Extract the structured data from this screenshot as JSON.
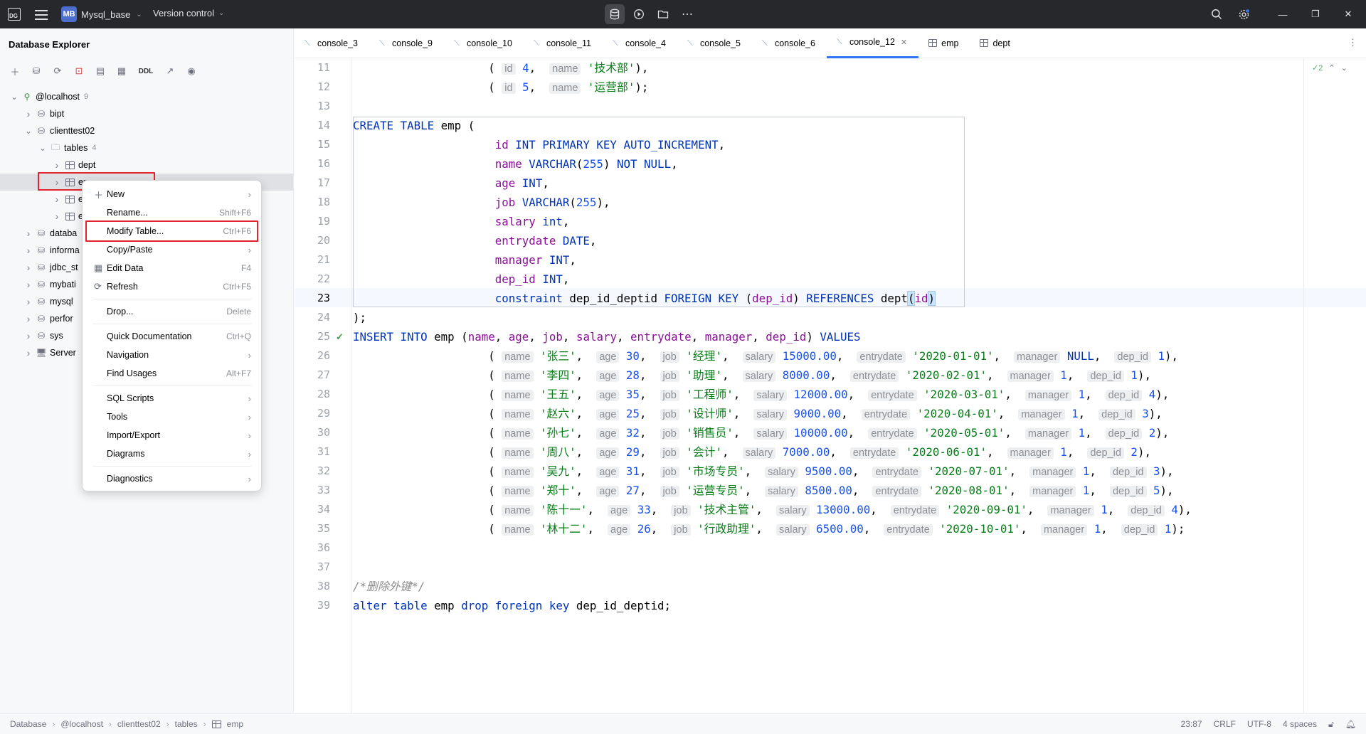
{
  "titlebar": {
    "project_badge": "MB",
    "project_name": "Mysql_base",
    "version_control": "Version control"
  },
  "left_panel": {
    "title": "Database Explorer",
    "ddl_label": "DDL",
    "tree": [
      {
        "label": "@localhost",
        "count": "9",
        "level": 0,
        "expanded": true,
        "icon": "host-icon"
      },
      {
        "label": "bipt",
        "level": 1,
        "icon": "schema-icon"
      },
      {
        "label": "clienttest02",
        "level": 1,
        "expanded": true,
        "icon": "schema-icon"
      },
      {
        "label": "tables",
        "count": "4",
        "level": 2,
        "expanded": true,
        "icon": "folder-icon"
      },
      {
        "label": "dept",
        "level": 3,
        "icon": "table-icon"
      },
      {
        "label": "emp",
        "level": 3,
        "icon": "table-icon",
        "selected": true
      },
      {
        "label": "e",
        "level": 3,
        "icon": "table-icon"
      },
      {
        "label": "e",
        "level": 3,
        "icon": "table-icon"
      },
      {
        "label": "databa",
        "level": 1,
        "icon": "schema-icon"
      },
      {
        "label": "informa",
        "level": 1,
        "icon": "schema-icon"
      },
      {
        "label": "jdbc_st",
        "level": 1,
        "icon": "schema-icon"
      },
      {
        "label": "mybati",
        "level": 1,
        "icon": "schema-icon"
      },
      {
        "label": "mysql",
        "level": 1,
        "icon": "schema-icon"
      },
      {
        "label": "perfor",
        "level": 1,
        "icon": "schema-icon"
      },
      {
        "label": "sys",
        "level": 1,
        "icon": "schema-icon"
      },
      {
        "label": "Server",
        "level": 1,
        "icon": "server-icon"
      }
    ]
  },
  "context_menu": {
    "items": [
      {
        "label": "New",
        "shortcut": "",
        "submenu": true,
        "icon": "plus-icon"
      },
      {
        "label": "Rename...",
        "shortcut": "Shift+F6"
      },
      {
        "label": "Modify Table...",
        "shortcut": "Ctrl+F6",
        "highlighted": true
      },
      {
        "label": "Copy/Paste",
        "shortcut": "",
        "submenu": true
      },
      {
        "label": "Edit Data",
        "shortcut": "F4",
        "icon": "table-icon"
      },
      {
        "label": "Refresh",
        "shortcut": "Ctrl+F5",
        "icon": "refresh-icon"
      },
      {
        "sep": true
      },
      {
        "label": "Drop...",
        "shortcut": "Delete"
      },
      {
        "sep": true
      },
      {
        "label": "Quick Documentation",
        "shortcut": "Ctrl+Q"
      },
      {
        "label": "Navigation",
        "shortcut": "",
        "submenu": true
      },
      {
        "label": "Find Usages",
        "shortcut": "Alt+F7"
      },
      {
        "sep": true
      },
      {
        "label": "SQL Scripts",
        "shortcut": "",
        "submenu": true
      },
      {
        "label": "Tools",
        "shortcut": "",
        "submenu": true
      },
      {
        "label": "Import/Export",
        "shortcut": "",
        "submenu": true
      },
      {
        "label": "Diagrams",
        "shortcut": "",
        "submenu": true
      },
      {
        "sep": true
      },
      {
        "label": "Diagnostics",
        "shortcut": "",
        "submenu": true
      }
    ]
  },
  "tabs": [
    {
      "label": "console_3",
      "type": "console"
    },
    {
      "label": "console_9",
      "type": "console"
    },
    {
      "label": "console_10",
      "type": "console"
    },
    {
      "label": "console_11",
      "type": "console"
    },
    {
      "label": "console_4",
      "type": "console"
    },
    {
      "label": "console_5",
      "type": "console"
    },
    {
      "label": "console_6",
      "type": "console"
    },
    {
      "label": "console_12",
      "type": "console",
      "active": true
    },
    {
      "label": "emp",
      "type": "table"
    },
    {
      "label": "dept",
      "type": "table"
    }
  ],
  "editor": {
    "inspection_count": "2",
    "current_line": 23,
    "lines": [
      {
        "n": "11",
        "html": "                    <span>( </span><span class=\"hint\">id</span> <span class=\"num\">4</span>,  <span class=\"hint\">name</span> <span class=\"str\">'技术部'</span>),"
      },
      {
        "n": "12",
        "html": "                    <span>( </span><span class=\"hint\">id</span> <span class=\"num\">5</span>,  <span class=\"hint\">name</span> <span class=\"str\">'运营部'</span>);"
      },
      {
        "n": "13",
        "html": ""
      },
      {
        "n": "14",
        "html": "<span class=\"kw\">CREATE TABLE</span> emp ("
      },
      {
        "n": "15",
        "html": "                     <span class=\"id\">id</span> <span class=\"kw\">INT PRIMARY KEY AUTO_INCREMENT</span>,"
      },
      {
        "n": "16",
        "html": "                     <span class=\"id\">name</span> <span class=\"kw\">VARCHAR</span>(<span class=\"num\">255</span>) <span class=\"kw\">NOT NULL</span>,"
      },
      {
        "n": "17",
        "html": "                     <span class=\"id\">age</span> <span class=\"kw\">INT</span>,"
      },
      {
        "n": "18",
        "html": "                     <span class=\"id\">job</span> <span class=\"kw\">VARCHAR</span>(<span class=\"num\">255</span>),"
      },
      {
        "n": "19",
        "html": "                     <span class=\"id\">salary</span> <span class=\"kw\">int</span>,"
      },
      {
        "n": "20",
        "html": "                     <span class=\"id\">entrydate</span> <span class=\"kw\">DATE</span>,"
      },
      {
        "n": "21",
        "html": "                     <span class=\"id\">manager</span> <span class=\"kw\">INT</span>,"
      },
      {
        "n": "22",
        "html": "                     <span class=\"id\">dep_id</span> <span class=\"kw\">INT</span>,"
      },
      {
        "n": "23",
        "html": "                     <span class=\"kw\">constraint</span> dep_id_deptid <span class=\"kw\">FOREIGN KEY</span> (<span class=\"id\">dep_id</span>) <span class=\"kw\">REFERENCES</span> dept<span class=\"brace\">(</span><span class=\"id\">id</span><span class=\"brace\">)</span>"
      },
      {
        "n": "24",
        "html": ");"
      },
      {
        "n": "25",
        "html": "<span class=\"kw\">INSERT INTO</span> emp (<span class=\"id\">name</span>, <span class=\"id\">age</span>, <span class=\"id\">job</span>, <span class=\"id\">salary</span>, <span class=\"id\">entrydate</span>, <span class=\"id\">manager</span>, <span class=\"id\">dep_id</span>) <span class=\"kw\">VALUES</span>"
      },
      {
        "n": "26",
        "html": "                    ( <span class=\"hint\">name</span> <span class=\"str\">'张三'</span>,  <span class=\"hint\">age</span> <span class=\"num\">30</span>,  <span class=\"hint\">job</span> <span class=\"str\">'经理'</span>,  <span class=\"hint\">salary</span> <span class=\"num\">15000.00</span>,  <span class=\"hint\">entrydate</span> <span class=\"str\">'2020-01-01'</span>,  <span class=\"hint\">manager</span> <span class=\"kw\">NULL</span>,  <span class=\"hint\">dep_id</span> <span class=\"num\">1</span>),"
      },
      {
        "n": "27",
        "html": "                    ( <span class=\"hint\">name</span> <span class=\"str\">'李四'</span>,  <span class=\"hint\">age</span> <span class=\"num\">28</span>,  <span class=\"hint\">job</span> <span class=\"str\">'助理'</span>,  <span class=\"hint\">salary</span> <span class=\"num\">8000.00</span>,  <span class=\"hint\">entrydate</span> <span class=\"str\">'2020-02-01'</span>,  <span class=\"hint\">manager</span> <span class=\"num\">1</span>,  <span class=\"hint\">dep_id</span> <span class=\"num\">1</span>),"
      },
      {
        "n": "28",
        "html": "                    ( <span class=\"hint\">name</span> <span class=\"str\">'王五'</span>,  <span class=\"hint\">age</span> <span class=\"num\">35</span>,  <span class=\"hint\">job</span> <span class=\"str\">'工程师'</span>,  <span class=\"hint\">salary</span> <span class=\"num\">12000.00</span>,  <span class=\"hint\">entrydate</span> <span class=\"str\">'2020-03-01'</span>,  <span class=\"hint\">manager</span> <span class=\"num\">1</span>,  <span class=\"hint\">dep_id</span> <span class=\"num\">4</span>),"
      },
      {
        "n": "29",
        "html": "                    ( <span class=\"hint\">name</span> <span class=\"str\">'赵六'</span>,  <span class=\"hint\">age</span> <span class=\"num\">25</span>,  <span class=\"hint\">job</span> <span class=\"str\">'设计师'</span>,  <span class=\"hint\">salary</span> <span class=\"num\">9000.00</span>,  <span class=\"hint\">entrydate</span> <span class=\"str\">'2020-04-01'</span>,  <span class=\"hint\">manager</span> <span class=\"num\">1</span>,  <span class=\"hint\">dep_id</span> <span class=\"num\">3</span>),"
      },
      {
        "n": "30",
        "html": "                    ( <span class=\"hint\">name</span> <span class=\"str\">'孙七'</span>,  <span class=\"hint\">age</span> <span class=\"num\">32</span>,  <span class=\"hint\">job</span> <span class=\"str\">'销售员'</span>,  <span class=\"hint\">salary</span> <span class=\"num\">10000.00</span>,  <span class=\"hint\">entrydate</span> <span class=\"str\">'2020-05-01'</span>,  <span class=\"hint\">manager</span> <span class=\"num\">1</span>,  <span class=\"hint\">dep_id</span> <span class=\"num\">2</span>),"
      },
      {
        "n": "31",
        "html": "                    ( <span class=\"hint\">name</span> <span class=\"str\">'周八'</span>,  <span class=\"hint\">age</span> <span class=\"num\">29</span>,  <span class=\"hint\">job</span> <span class=\"str\">'会计'</span>,  <span class=\"hint\">salary</span> <span class=\"num\">7000.00</span>,  <span class=\"hint\">entrydate</span> <span class=\"str\">'2020-06-01'</span>,  <span class=\"hint\">manager</span> <span class=\"num\">1</span>,  <span class=\"hint\">dep_id</span> <span class=\"num\">2</span>),"
      },
      {
        "n": "32",
        "html": "                    ( <span class=\"hint\">name</span> <span class=\"str\">'吴九'</span>,  <span class=\"hint\">age</span> <span class=\"num\">31</span>,  <span class=\"hint\">job</span> <span class=\"str\">'市场专员'</span>,  <span class=\"hint\">salary</span> <span class=\"num\">9500.00</span>,  <span class=\"hint\">entrydate</span> <span class=\"str\">'2020-07-01'</span>,  <span class=\"hint\">manager</span> <span class=\"num\">1</span>,  <span class=\"hint\">dep_id</span> <span class=\"num\">3</span>),"
      },
      {
        "n": "33",
        "html": "                    ( <span class=\"hint\">name</span> <span class=\"str\">'郑十'</span>,  <span class=\"hint\">age</span> <span class=\"num\">27</span>,  <span class=\"hint\">job</span> <span class=\"str\">'运营专员'</span>,  <span class=\"hint\">salary</span> <span class=\"num\">8500.00</span>,  <span class=\"hint\">entrydate</span> <span class=\"str\">'2020-08-01'</span>,  <span class=\"hint\">manager</span> <span class=\"num\">1</span>,  <span class=\"hint\">dep_id</span> <span class=\"num\">5</span>),"
      },
      {
        "n": "34",
        "html": "                    ( <span class=\"hint\">name</span> <span class=\"str\">'陈十一'</span>,  <span class=\"hint\">age</span> <span class=\"num\">33</span>,  <span class=\"hint\">job</span> <span class=\"str\">'技术主管'</span>,  <span class=\"hint\">salary</span> <span class=\"num\">13000.00</span>,  <span class=\"hint\">entrydate</span> <span class=\"str\">'2020-09-01'</span>,  <span class=\"hint\">manager</span> <span class=\"num\">1</span>,  <span class=\"hint\">dep_id</span> <span class=\"num\">4</span>),"
      },
      {
        "n": "35",
        "html": "                    ( <span class=\"hint\">name</span> <span class=\"str\">'林十二'</span>,  <span class=\"hint\">age</span> <span class=\"num\">26</span>,  <span class=\"hint\">job</span> <span class=\"str\">'行政助理'</span>,  <span class=\"hint\">salary</span> <span class=\"num\">6500.00</span>,  <span class=\"hint\">entrydate</span> <span class=\"str\">'2020-10-01'</span>,  <span class=\"hint\">manager</span> <span class=\"num\">1</span>,  <span class=\"hint\">dep_id</span> <span class=\"num\">1</span>);"
      },
      {
        "n": "36",
        "html": ""
      },
      {
        "n": "37",
        "html": ""
      },
      {
        "n": "38",
        "html": "<span class=\"cm\">/*删除外键*/</span>"
      },
      {
        "n": "39",
        "html": "<span class=\"kw\">alter table</span> emp <span class=\"kw\">drop foreign key</span> dep_id_deptid;"
      }
    ]
  },
  "statusbar": {
    "breadcrumb": [
      "Database",
      "@localhost",
      "clienttest02",
      "tables",
      "emp"
    ],
    "position": "23:87",
    "line_sep": "CRLF",
    "encoding": "UTF-8",
    "indent": "4 spaces"
  }
}
